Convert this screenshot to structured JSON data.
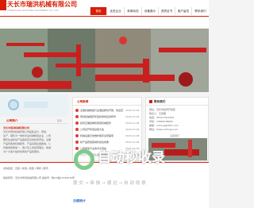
{
  "header": {
    "logo_text": "天长市瑞洪机械有限公司",
    "logo_sub": "TIANCHANG RUIHONG MACHINERY CO.,LTD."
  },
  "nav": [
    {
      "label": "首页",
      "active": true
    },
    {
      "label": "走进企业",
      "active": false
    },
    {
      "label": "新闻动态",
      "active": false
    },
    {
      "label": "设备展示",
      "active": false
    },
    {
      "label": "资质证书",
      "active": false
    },
    {
      "label": "客户留言",
      "active": false
    },
    {
      "label": "联系我们",
      "active": false
    }
  ],
  "banner": {
    "watermark_cn": "自动秒收录",
    "watermark_sub": "提 交 → 审 核 → 通 过 → 自 动 收 录"
  },
  "company": {
    "title": "公司简介",
    "more": "更多",
    "name": "天长市瑞洪机械有限公司",
    "intro_lines": [
      "天长市瑞洪机械有限公司是集设计、研发、",
      "生产、销售为一体的专业机械制造企业，公司",
      "拥有先进的生产设备和完善的检测手段。主要",
      "产品有各类机械配件，产品远销全国各地。公",
      "司秉承质量第一、客户至上的经营理念，竭诚",
      "为广大客户提供优质的产品和服务。"
    ]
  },
  "news": {
    "title": "公司新闻",
    "items": [
      {
        "text": "全国机械制造行业展会即将开幕，欢迎莅临参观",
        "date": "2024-12-06"
      },
      {
        "text": "瑞洪机械荣获年度优秀供应商称号",
        "date": "2024-12-06"
      },
      {
        "text": "如何正确选择和使用机械配件",
        "date": "2024-12-06"
      },
      {
        "text": "公司召开年度总结大会",
        "date": "2024-12-06"
      },
      {
        "text": "机械设备日常维护保养注意事项",
        "date": "2024-12-06"
      },
      {
        "text": "新产品研发取得阶段性成果",
        "date": "2024-12-06"
      },
      {
        "text": "公司参加行业技术交流会",
        "date": "2024-12-06"
      },
      {
        "text": "质量管理体系认证顺利通过",
        "date": "2024-12-06"
      }
    ]
  },
  "contact": {
    "title": "联系我们",
    "lines": [
      "地址：天长市经济开发区",
      "联系人：王经理",
      "电话：0550-7012345",
      "手机：13800138000",
      "邮箱：ruihong@163.com",
      "网址：www.ruihong.com"
    ],
    "img_caption": "设备展示"
  },
  "footer": {
    "line1": "友情链接：百度 | 新浪 | 搜狐 | 网易 | 腾讯",
    "line2": "版权所有：天长市瑞洪机械有限公司 备案号：皖ICP备12345678号",
    "badge": "百度统计"
  }
}
